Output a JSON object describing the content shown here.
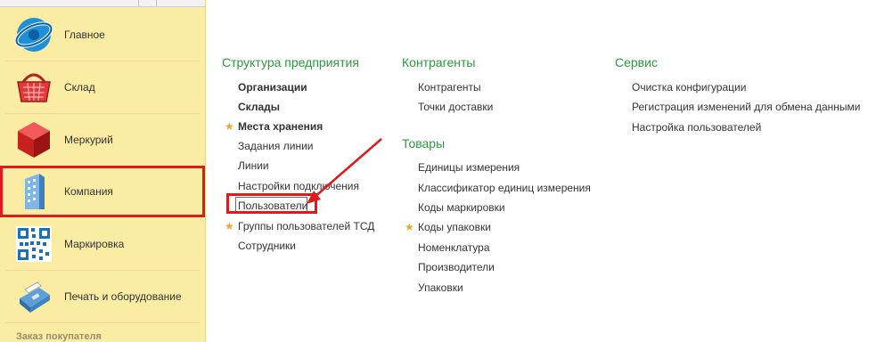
{
  "sidebar": {
    "items": [
      {
        "label": "Главное",
        "icon": "globe-icon"
      },
      {
        "label": "Склад",
        "icon": "basket-icon"
      },
      {
        "label": "Меркурий",
        "icon": "cube-icon"
      },
      {
        "label": "Компания",
        "icon": "building-icon"
      },
      {
        "label": "Маркировка",
        "icon": "qr-code-icon"
      },
      {
        "label": "Печать и оборудование",
        "icon": "printer-terminal-icon"
      }
    ],
    "footer": "Заказ покупателя"
  },
  "sections": {
    "structure": {
      "title": "Структура предприятия",
      "items": [
        {
          "label": "Организации",
          "bold": true,
          "starred": false
        },
        {
          "label": "Склады",
          "bold": true,
          "starred": false
        },
        {
          "label": "Места хранения",
          "bold": true,
          "starred": true
        },
        {
          "label": "Задания линии",
          "bold": false,
          "starred": false
        },
        {
          "label": "Линии",
          "bold": false,
          "starred": false
        },
        {
          "label": "Настройки подключения",
          "bold": false,
          "starred": false
        },
        {
          "label": "Пользователи",
          "bold": false,
          "starred": false
        },
        {
          "label": "Группы пользователей ТСД",
          "bold": false,
          "starred": true
        },
        {
          "label": "Сотрудники",
          "bold": false,
          "starred": false
        }
      ]
    },
    "contractors": {
      "title": "Контрагенты",
      "items": [
        {
          "label": "Контрагенты"
        },
        {
          "label": "Точки доставки"
        }
      ]
    },
    "goods": {
      "title": "Товары",
      "items": [
        {
          "label": "Единицы измерения",
          "starred": false
        },
        {
          "label": "Классификатор единиц измерения",
          "starred": false
        },
        {
          "label": "Коды маркировки",
          "starred": false
        },
        {
          "label": "Коды упаковки",
          "starred": true
        },
        {
          "label": "Номенклатура",
          "starred": false
        },
        {
          "label": "Производители",
          "starred": false
        },
        {
          "label": "Упаковки",
          "starred": false
        }
      ]
    },
    "service": {
      "title": "Сервис",
      "items": [
        {
          "label": "Очистка конфигурации"
        },
        {
          "label": "Регистрация изменений для обмена данными"
        },
        {
          "label": "Настройка пользователей"
        }
      ]
    }
  },
  "colors": {
    "sidebar_bg": "#fbeca3",
    "section_header": "#2a9a3c",
    "star": "#f4a622",
    "annotation_red": "#e01a1a"
  }
}
